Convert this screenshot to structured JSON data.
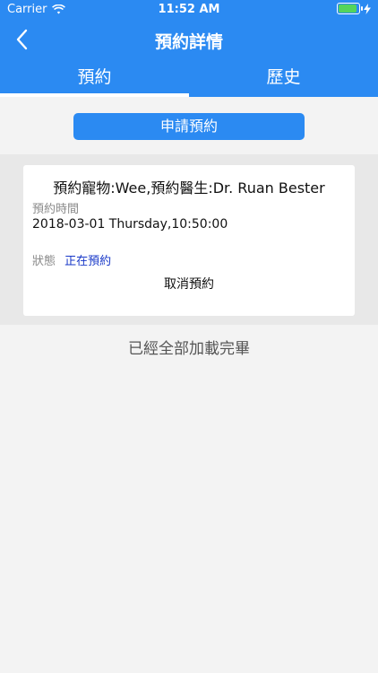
{
  "statusbar": {
    "carrier": "Carrier",
    "time": "11:52 AM"
  },
  "navbar": {
    "title": "預約詳情",
    "back_icon": "back-chevron-icon"
  },
  "tabs": [
    {
      "label": "預約",
      "active": true
    },
    {
      "label": "歷史",
      "active": false
    }
  ],
  "apply_button": "申請預約",
  "appointment": {
    "title": "預約寵物:Wee,預約醫生:Dr. Ruan Bester",
    "time_label": "預約時間",
    "time_value": "2018-03-01 Thursday,10:50:00",
    "status_label": "狀態",
    "status_value": "正在預約",
    "cancel_label": "取消預約"
  },
  "footer": "已經全部加載完畢",
  "colors": {
    "primary": "#2b8af2",
    "status_text": "#1838c8",
    "background": "#f3f3f3"
  }
}
